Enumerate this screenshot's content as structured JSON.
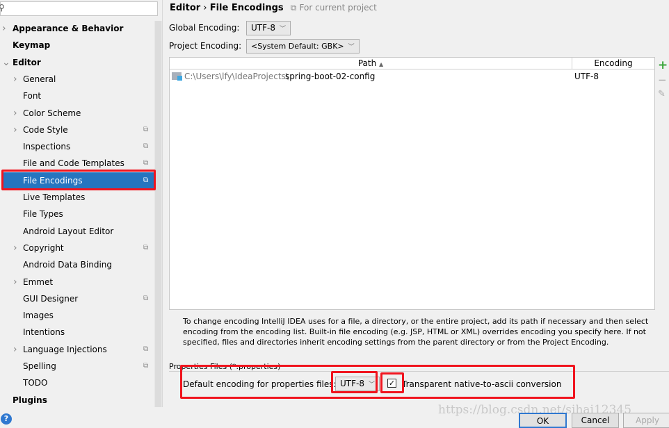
{
  "search": {
    "placeholder": "",
    "icon": "search-icon"
  },
  "sidebar": {
    "items": [
      {
        "label": "Appearance & Behavior",
        "level": 0,
        "bold": true,
        "arrow": "right"
      },
      {
        "label": "Keymap",
        "level": 0,
        "bold": true
      },
      {
        "label": "Editor",
        "level": 0,
        "bold": true,
        "arrow": "down"
      },
      {
        "label": "General",
        "level": 1,
        "arrow": "right"
      },
      {
        "label": "Font",
        "level": 1
      },
      {
        "label": "Color Scheme",
        "level": 1,
        "arrow": "right"
      },
      {
        "label": "Code Style",
        "level": 1,
        "arrow": "right",
        "project": true
      },
      {
        "label": "Inspections",
        "level": 1,
        "project": true
      },
      {
        "label": "File and Code Templates",
        "level": 1,
        "project": true
      },
      {
        "label": "File Encodings",
        "level": 1,
        "project": true,
        "selected": true
      },
      {
        "label": "Live Templates",
        "level": 1
      },
      {
        "label": "File Types",
        "level": 1
      },
      {
        "label": "Android Layout Editor",
        "level": 1
      },
      {
        "label": "Copyright",
        "level": 1,
        "arrow": "right",
        "project": true
      },
      {
        "label": "Android Data Binding",
        "level": 1
      },
      {
        "label": "Emmet",
        "level": 1,
        "arrow": "right"
      },
      {
        "label": "GUI Designer",
        "level": 1,
        "project": true
      },
      {
        "label": "Images",
        "level": 1
      },
      {
        "label": "Intentions",
        "level": 1
      },
      {
        "label": "Language Injections",
        "level": 1,
        "arrow": "right",
        "project": true
      },
      {
        "label": "Spelling",
        "level": 1,
        "project": true
      },
      {
        "label": "TODO",
        "level": 1
      },
      {
        "label": "Plugins",
        "level": 0,
        "bold": true
      }
    ]
  },
  "header": {
    "crumb1": "Editor",
    "sep": "›",
    "crumb2": "File Encodings",
    "scope": "For current project"
  },
  "global": {
    "label": "Global Encoding:",
    "value": "UTF-8"
  },
  "project": {
    "label": "Project Encoding:",
    "value": "<System Default: GBK>"
  },
  "table": {
    "columns": [
      "Path",
      "Encoding"
    ],
    "sort": "ascending",
    "rows": [
      {
        "path_prefix": "C:\\Users\\lfy\\IdeaProjects\\",
        "path_name": "spring-boot-02-config",
        "encoding": "UTF-8"
      }
    ]
  },
  "help_text": "To change encoding IntelliJ IDEA uses for a file, a directory, or the entire project, add its path if necessary and then select encoding from the encoding list. Built-in file encoding (e.g. JSP, HTML or XML) overrides encoding you specify here. If not specified, files and directories inherit encoding settings from the parent directory or from the Project Encoding.",
  "properties": {
    "group": "Properties Files (*.properties)",
    "label": "Default encoding for properties files:",
    "value": "UTF-8",
    "checkbox_label": "Transparent native-to-ascii conversion",
    "checked": true
  },
  "buttons": {
    "ok": "OK",
    "cancel": "Cancel",
    "apply": "Apply"
  },
  "watermark": "https://blog.csdn.net/sihai12345",
  "colors": {
    "selection": "#2675bf",
    "highlight": "#f0141e"
  }
}
